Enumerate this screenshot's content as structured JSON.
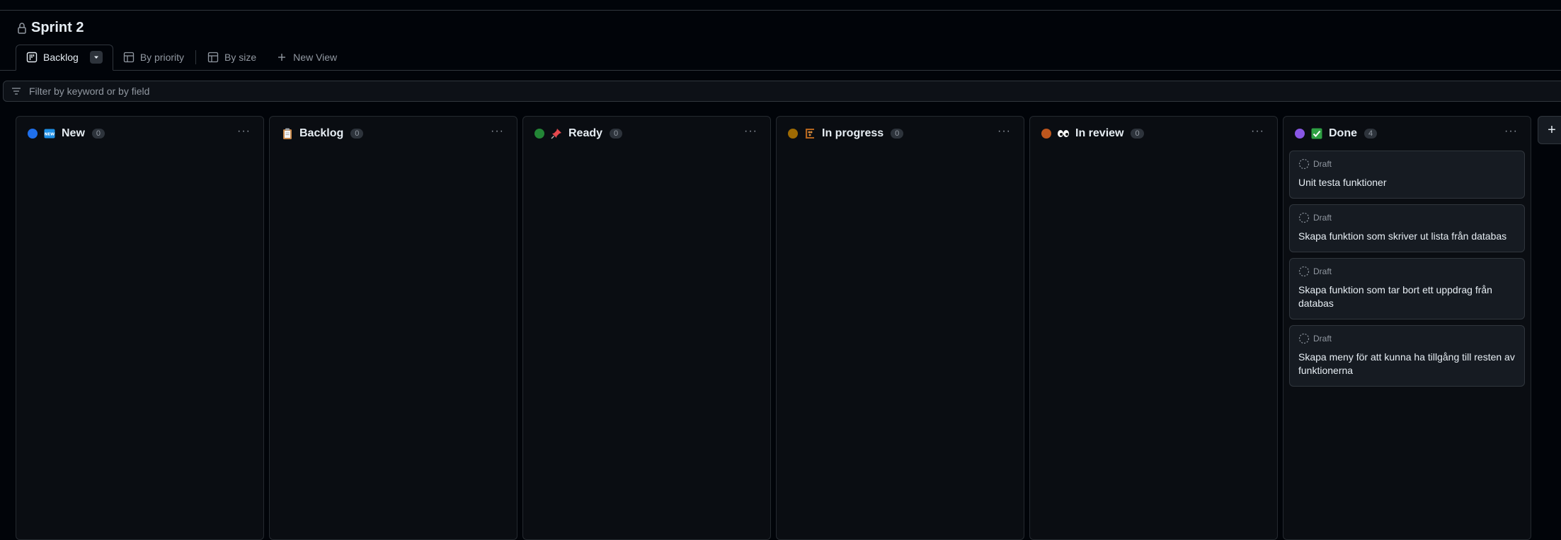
{
  "project": {
    "title": "Sprint 2"
  },
  "tabs": [
    {
      "label": "Backlog",
      "icon": "board-icon",
      "active": true
    },
    {
      "label": "By priority",
      "icon": "table-icon"
    },
    {
      "label": "By size",
      "icon": "table-icon"
    },
    {
      "label": "New View",
      "icon": "plus-icon"
    }
  ],
  "filter": {
    "placeholder": "Filter by keyword or by field"
  },
  "columns": [
    {
      "name": "New",
      "count": "0",
      "color": "#1f6feb",
      "emoji": "new-badge-icon"
    },
    {
      "name": "Backlog",
      "count": "0",
      "color": "",
      "emoji": "clipboard-icon"
    },
    {
      "name": "Ready",
      "count": "0",
      "color": "#238636",
      "emoji": "pushpin-icon"
    },
    {
      "name": "In progress",
      "count": "0",
      "color": "#9e6a03",
      "emoji": "abacus-icon"
    },
    {
      "name": "In review",
      "count": "0",
      "color": "#bd561d",
      "emoji": "eyes-icon"
    },
    {
      "name": "Done",
      "count": "4",
      "color": "#8957e5",
      "emoji": "check-box-icon",
      "cards": [
        {
          "status": "Draft",
          "title": "Unit testa funktioner"
        },
        {
          "status": "Draft",
          "title": "Skapa funktion som skriver ut lista från databas"
        },
        {
          "status": "Draft",
          "title": "Skapa funktion som tar bort ett uppdrag från databas"
        },
        {
          "status": "Draft",
          "title": "Skapa meny för att kunna ha tillgång till resten av funktionerna"
        }
      ]
    }
  ],
  "add_column": {
    "label": "+"
  }
}
